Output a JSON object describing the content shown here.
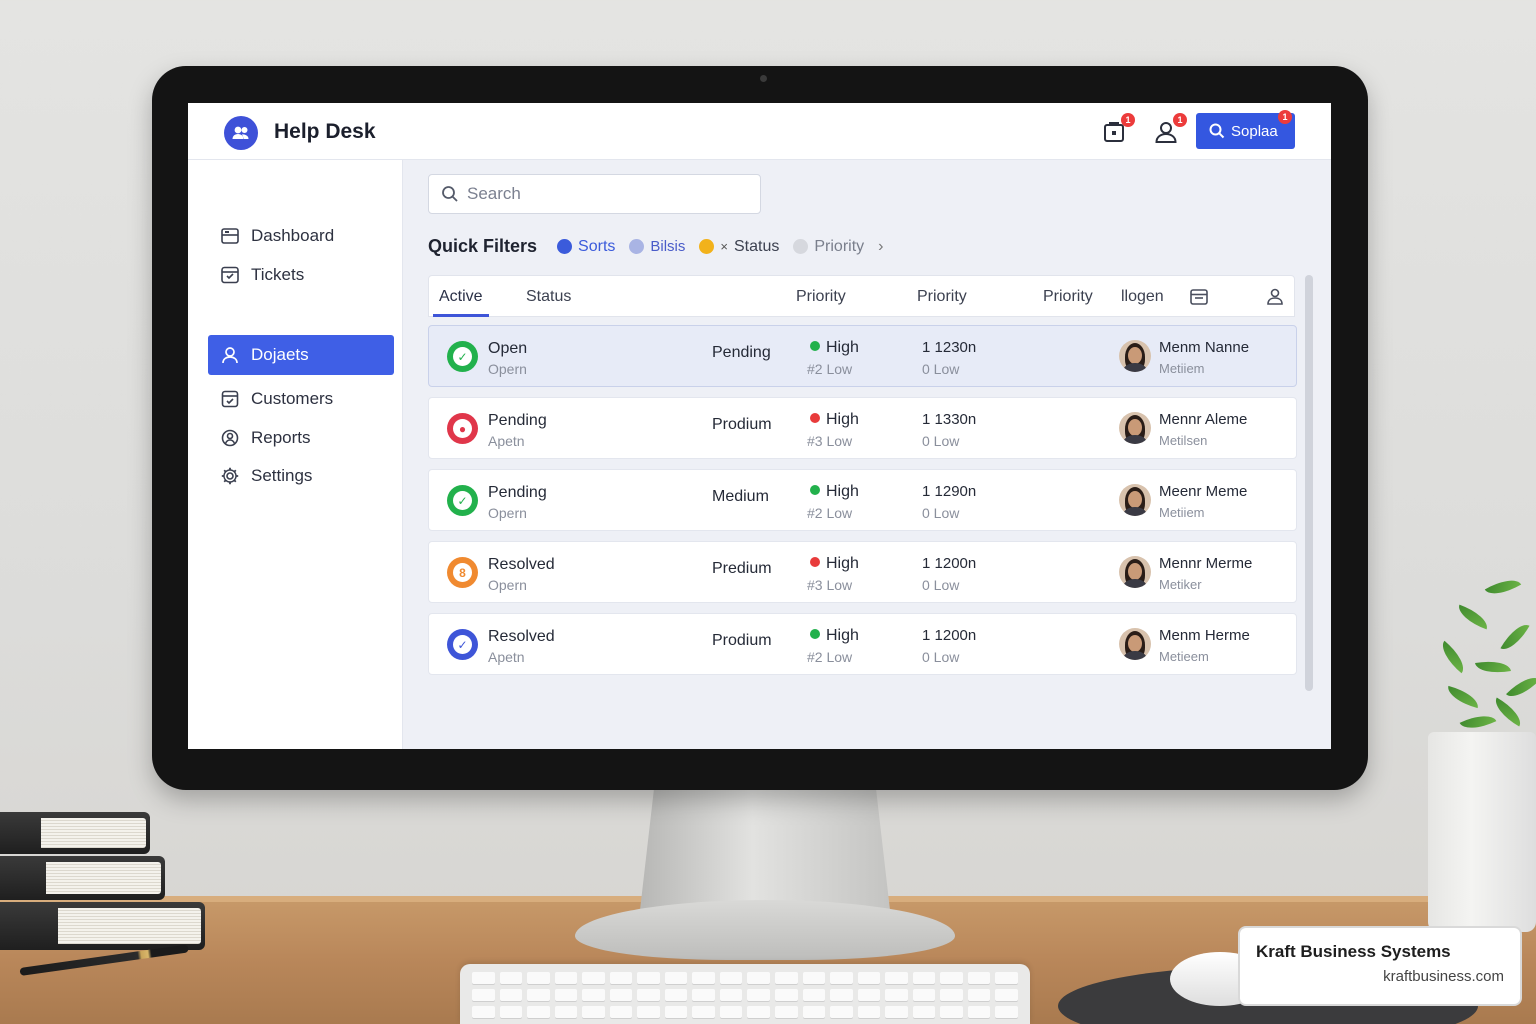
{
  "app": {
    "title": "Help Desk",
    "header_button_label": "Soplaa",
    "notification_badge": "1",
    "user_badge": "1",
    "button_badge": "1"
  },
  "sidebar": {
    "items": [
      {
        "label": "Dashboard",
        "icon": "dashboard-icon"
      },
      {
        "label": "Tickets",
        "icon": "ticket-icon"
      },
      {
        "label": "Dojaets",
        "icon": "user-icon",
        "active": true
      },
      {
        "label": "Customers",
        "icon": "customers-icon"
      },
      {
        "label": "Reports",
        "icon": "reports-icon"
      },
      {
        "label": "Settings",
        "icon": "gear-icon"
      }
    ]
  },
  "search": {
    "placeholder": "Search",
    "value": ""
  },
  "filters": {
    "label": "Quick Filters",
    "chips": [
      {
        "label": "Sorts",
        "color": "#3b5bdb"
      },
      {
        "label": "Bilsis",
        "color": "#a9b4e4"
      },
      {
        "label": "Status",
        "color": "#f2b21b",
        "prefix": "×"
      },
      {
        "label": "Priority",
        "color": "#d6d8de"
      }
    ]
  },
  "table": {
    "columns": [
      "Active",
      "Status",
      "Priority",
      "Priority",
      "Priority",
      "llogen"
    ],
    "rows": [
      {
        "status": "Open",
        "sub": "Opern",
        "level": "Pending",
        "priority": "High",
        "priority_color": "#22b14c",
        "priority_sub": "#2 Low",
        "time": "1 1230n",
        "time_sub": "0 Low",
        "assignee": "Menm Nanne",
        "assignee_sub": "Metiiem",
        "icon_color": "#22b14c",
        "icon_glyph": "✓"
      },
      {
        "status": "Pending",
        "sub": "Apetn",
        "level": "Prodium",
        "priority": "High",
        "priority_color": "#e83b3b",
        "priority_sub": "#3 Low",
        "time": "1 1330n",
        "time_sub": "0 Low",
        "assignee": "Mennr Aleme",
        "assignee_sub": "Metilsen",
        "icon_color": "#e0364a",
        "icon_glyph": "●"
      },
      {
        "status": "Pending",
        "sub": "Opern",
        "level": "Medium",
        "priority": "High",
        "priority_color": "#22b14c",
        "priority_sub": "#2 Low",
        "time": "1 1290n",
        "time_sub": "0 Low",
        "assignee": "Meenr Meme",
        "assignee_sub": "Metiiem",
        "icon_color": "#22b14c",
        "icon_glyph": "✓"
      },
      {
        "status": "Resolved",
        "sub": "Opern",
        "level": "Predium",
        "priority": "High",
        "priority_color": "#e83b3b",
        "priority_sub": "#3 Low",
        "time": "1 1200n",
        "time_sub": "0 Low",
        "assignee": "Mennr Merme",
        "assignee_sub": "Metiker",
        "icon_color": "#f08a30",
        "icon_glyph": "8"
      },
      {
        "status": "Resolved",
        "sub": "Apetn",
        "level": "Prodium",
        "priority": "High",
        "priority_color": "#22b14c",
        "priority_sub": "#2 Low",
        "time": "1 1200n",
        "time_sub": "0 Low",
        "assignee": "Menm Herme",
        "assignee_sub": "Metieem",
        "icon_color": "#3e55d8",
        "icon_glyph": "✓"
      }
    ]
  },
  "brand": {
    "name": "Kraft Business Systems",
    "url": "kraftbusiness.com"
  }
}
